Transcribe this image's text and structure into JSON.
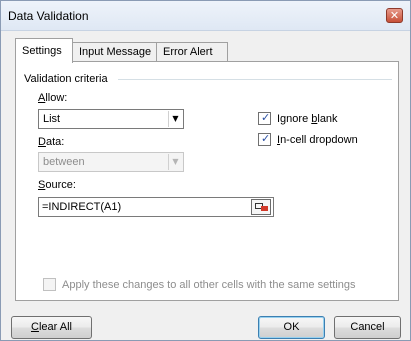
{
  "window": {
    "title": "Data Validation",
    "close_glyph": "✕"
  },
  "tabs": [
    {
      "label": "Settings",
      "active": true
    },
    {
      "label": "Input Message",
      "active": false
    },
    {
      "label": "Error Alert",
      "active": false
    }
  ],
  "settings": {
    "group_label": "Validation criteria",
    "allow": {
      "label_mnemonic": "A",
      "label_rest": "llow:",
      "value": "List"
    },
    "data": {
      "label_mnemonic": "D",
      "label_rest": "ata:",
      "value": "between",
      "disabled": true
    },
    "source": {
      "label_mnemonic": "S",
      "label_rest": "ource:",
      "value": "=INDIRECT(A1)"
    },
    "ignore_blank": {
      "label_pre": "Ignore ",
      "label_mnemonic": "b",
      "label_post": "lank",
      "checked": true
    },
    "in_cell_dropdown": {
      "label_pre": "",
      "label_mnemonic": "I",
      "label_post": "n-cell dropdown",
      "checked": true
    },
    "apply_all": {
      "label": "Apply these changes to all other cells with the same settings",
      "checked": false,
      "disabled": true
    }
  },
  "buttons": {
    "clear_all": {
      "label_mnemonic": "C",
      "label_rest": "lear All"
    },
    "ok": {
      "label": "OK"
    },
    "cancel": {
      "label": "Cancel"
    }
  },
  "glyphs": {
    "check": "✓",
    "dropdown_arrow": "▼"
  },
  "colors": {
    "close_button": "#c75038",
    "checkmark": "#2a4fa3"
  }
}
